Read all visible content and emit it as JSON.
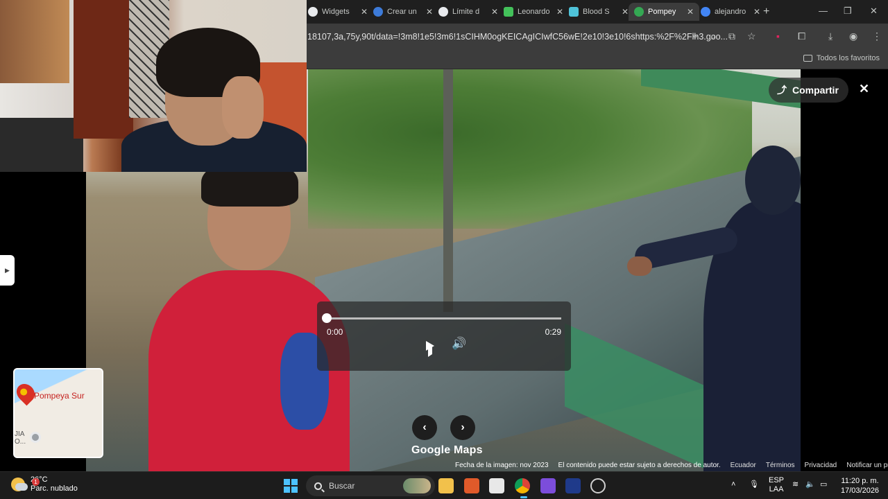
{
  "browser": {
    "tabs": [
      {
        "title": "Widgets",
        "favicon": "widgets-icon",
        "color": "#e8eaed"
      },
      {
        "title": "Crear un",
        "favicon": "paypal-icon",
        "color": "#3d7bd9"
      },
      {
        "title": "Límite d",
        "favicon": "openai-icon",
        "color": "#e8eaed"
      },
      {
        "title": "Leonardo",
        "favicon": "leonardo-icon",
        "color": "#43c15a"
      },
      {
        "title": "Blood S",
        "favicon": "app-icon",
        "color": "#4fc3d9"
      },
      {
        "title": "Pompey",
        "favicon": "maps-pin-icon",
        "color": "#34a853",
        "active": true
      },
      {
        "title": "alejandro",
        "favicon": "google-icon",
        "color": "#4285f4"
      }
    ],
    "new_tab": "+",
    "url": "18107,3a,75y,90t/data=!3m8!1e5!3m6!1sCIHM0ogKEICAgICIwfC56wE!2e10!3e10!6shttps:%2F%2Flh3.goo...",
    "bookmarks_all": "Todos los favoritos"
  },
  "streetview": {
    "share_label": "Compartir",
    "player": {
      "time_current": "0:00",
      "time_total": "0:29",
      "progress": 0
    },
    "logo_google": "Google",
    "logo_maps": "Maps",
    "minimap": {
      "place_label": "Pompeya Sur",
      "fragment": "JIA\nO..."
    },
    "attribution": {
      "date": "Fecha de la imagen: nov 2023",
      "copyright": "El contenido puede estar sujeto a derechos de autor.",
      "country": "Ecuador",
      "terms": "Términos",
      "privacy": "Privacidad",
      "report": "Notificar un problema"
    }
  },
  "taskbar": {
    "weather_temp": "26°C",
    "weather_desc": "Parc. nublado",
    "weather_badge": "1",
    "search_placeholder": "Buscar",
    "lang_top": "ESP",
    "lang_bottom": "LAA",
    "time": "11:20 p. m.",
    "date": "17/03/2026"
  }
}
